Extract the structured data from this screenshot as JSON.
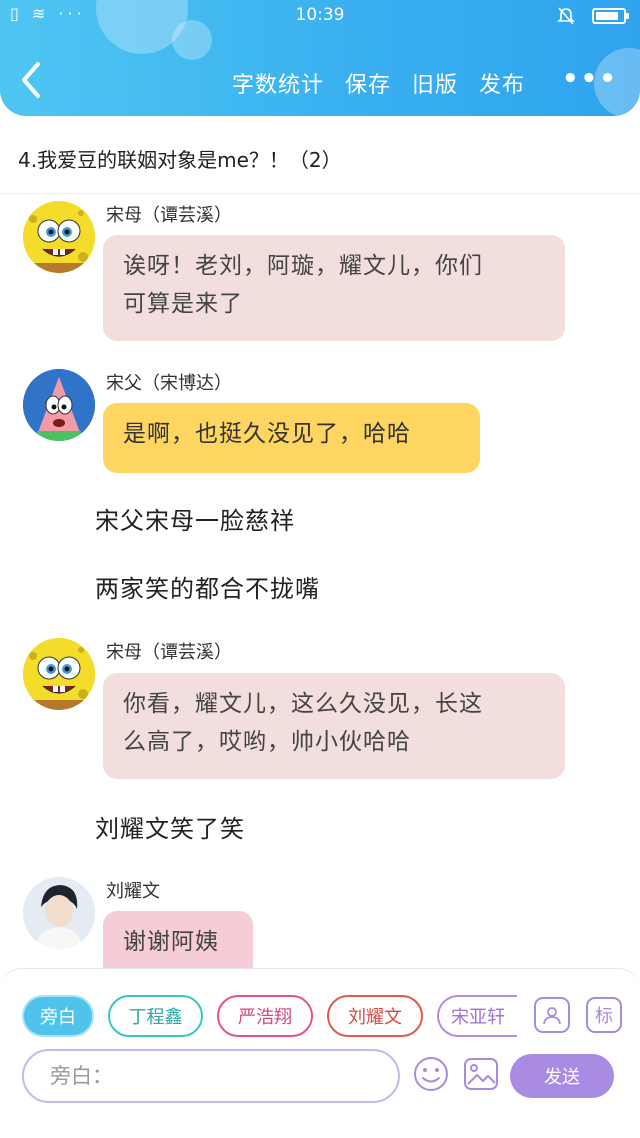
{
  "status_bar": {
    "time": "10:39",
    "left_icons": "▯ ≋ ···",
    "battery_level": 0.85
  },
  "header": {
    "toolbar": [
      "字数统计",
      "保存",
      "旧版",
      "发布"
    ],
    "more_label": "•••"
  },
  "story_title": "4.我爱豆的联姻对象是me？！（2）",
  "messages": [
    {
      "speaker": "宋母（谭芸溪）",
      "text_lines": [
        "诶呀！老刘，阿璇，耀文儿，你们",
        "可算是来了"
      ],
      "style": "pink",
      "avatar": "spongebob-avatar"
    },
    {
      "speaker": "宋父（宋博达）",
      "text_lines": [
        "是啊，也挺久没见了，哈哈"
      ],
      "style": "yellow",
      "avatar": "patrick-avatar"
    },
    {
      "narration": "宋父宋母一脸慈祥"
    },
    {
      "narration": "两家笑的都合不拢嘴"
    },
    {
      "speaker": "宋母（谭芸溪）",
      "text_lines": [
        "你看，耀文儿，这么久没见，长这",
        "么高了，哎哟，帅小伙哈哈"
      ],
      "style": "pink",
      "avatar": "spongebob-avatar"
    },
    {
      "narration": "刘耀文笑了笑"
    },
    {
      "speaker": "刘耀文",
      "text_lines": [
        "谢谢阿姨"
      ],
      "style": "pink",
      "avatar": "person-avatar"
    }
  ],
  "role_chips": [
    {
      "label": "旁白",
      "color": "#4fc3ec",
      "active": true
    },
    {
      "label": "丁程鑫",
      "color": "#3cc4c0",
      "active": false
    },
    {
      "label": "严浩翔",
      "color": "#e0558a",
      "active": false
    },
    {
      "label": "刘耀文",
      "color": "#e05a4e",
      "active": false
    },
    {
      "label": "宋亚轩",
      "color": "#b58ae0",
      "active": false
    }
  ],
  "role_icon_label": "标",
  "input": {
    "placeholder": "旁白："
  },
  "send_label": "发送",
  "colors": {
    "accent": "#3ab0f0",
    "purple": "#a98be4",
    "pink_bubble": "#f3dede",
    "yellow_bubble": "#fdd560"
  }
}
